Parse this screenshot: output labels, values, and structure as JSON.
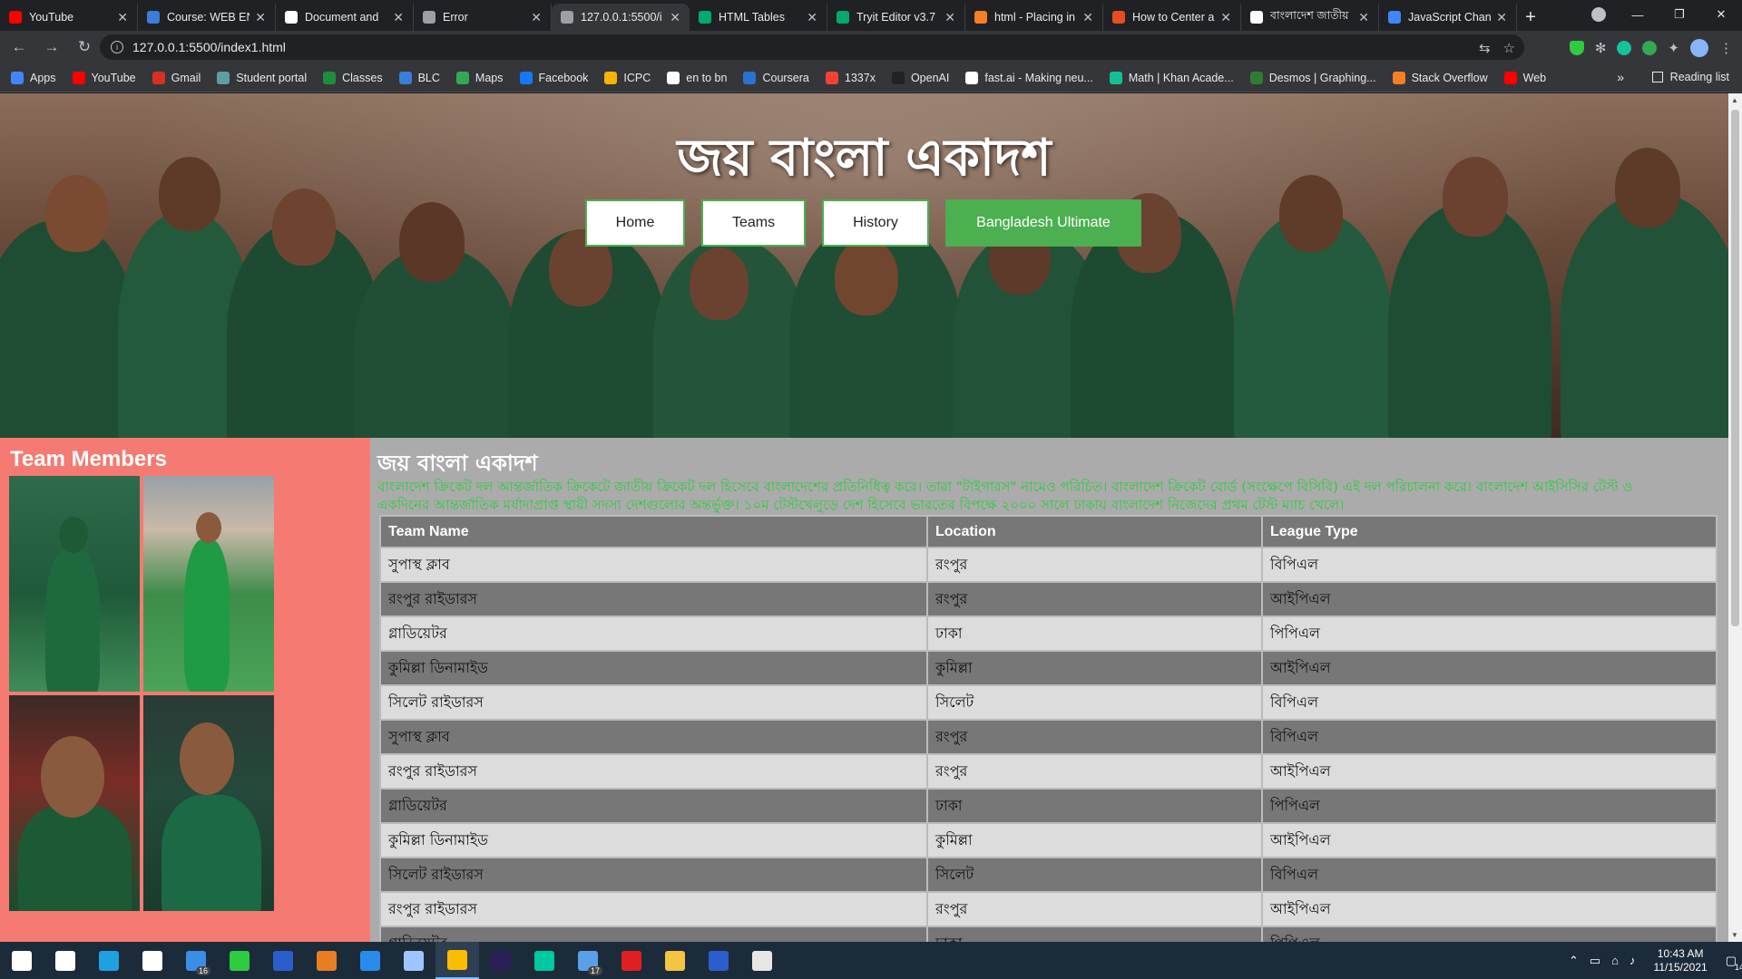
{
  "browser": {
    "tabs": [
      {
        "label": "YouTube",
        "icon": "youtube-icon",
        "color": "#ff0000"
      },
      {
        "label": "Course: WEB EN",
        "icon": "course-icon",
        "color": "#3b7dd8"
      },
      {
        "label": "Document and",
        "icon": "github-icon",
        "color": "#ffffff"
      },
      {
        "label": "Error",
        "icon": "globe-icon",
        "color": "#9aa0a6"
      },
      {
        "label": "127.0.0.1:5500/i",
        "icon": "globe-icon",
        "color": "#9aa0a6",
        "active": true
      },
      {
        "label": "HTML Tables",
        "icon": "w3schools-icon",
        "color": "#04aa6d"
      },
      {
        "label": "Tryit Editor v3.7",
        "icon": "w3schools-icon",
        "color": "#04aa6d"
      },
      {
        "label": "html - Placing in",
        "icon": "stackoverflow-icon",
        "color": "#f48024"
      },
      {
        "label": "How to Center a",
        "icon": "html5-icon",
        "color": "#e44d26"
      },
      {
        "label": "বাংলাদেশ জাতীয়",
        "icon": "wikipedia-icon",
        "color": "#ffffff"
      },
      {
        "label": "JavaScript Chan",
        "icon": "google-icon",
        "color": "#4285f4"
      }
    ],
    "url": "127.0.0.1:5500/index1.html",
    "bookmarks": [
      {
        "label": "Apps",
        "icon": "apps-icon",
        "color": "#4285f4"
      },
      {
        "label": "YouTube",
        "icon": "youtube-icon",
        "color": "#ff0000"
      },
      {
        "label": "Gmail",
        "icon": "gmail-icon",
        "color": "#d93025"
      },
      {
        "label": "Student portal",
        "icon": "portal-icon",
        "color": "#5f9ea0"
      },
      {
        "label": "Classes",
        "icon": "classroom-icon",
        "color": "#1e8e3e"
      },
      {
        "label": "BLC",
        "icon": "blc-icon",
        "color": "#3b7dd8"
      },
      {
        "label": "Maps",
        "icon": "maps-icon",
        "color": "#34a853"
      },
      {
        "label": "Facebook",
        "icon": "facebook-icon",
        "color": "#1877f2"
      },
      {
        "label": "ICPC",
        "icon": "icpc-icon",
        "color": "#f4b400"
      },
      {
        "label": "en to bn",
        "icon": "google-icon",
        "color": "#ffffff"
      },
      {
        "label": "Coursera",
        "icon": "coursera-icon",
        "color": "#2a73cc"
      },
      {
        "label": "1337x",
        "icon": "x-icon",
        "color": "#f44336"
      },
      {
        "label": "OpenAI",
        "icon": "openai-icon",
        "color": "#222222"
      },
      {
        "label": "fast.ai - Making neu...",
        "icon": "fastai-icon",
        "color": "#ffffff"
      },
      {
        "label": "Math | Khan Acade...",
        "icon": "khan-icon",
        "color": "#14bf96"
      },
      {
        "label": "Desmos | Graphing...",
        "icon": "desmos-icon",
        "color": "#2e7d32"
      },
      {
        "label": "Stack Overflow",
        "icon": "stackoverflow-icon",
        "color": "#f48024"
      },
      {
        "label": "Web",
        "icon": "youtube-icon",
        "color": "#ff0000"
      }
    ],
    "bookmarks_more": "»",
    "reading_list": "Reading list"
  },
  "page": {
    "hero_title": "জয় বাংলা একাদশ",
    "nav": [
      {
        "label": "Home",
        "active": false
      },
      {
        "label": "Teams",
        "active": false
      },
      {
        "label": "History",
        "active": false
      },
      {
        "label": "Bangladesh Ultimate",
        "active": true
      }
    ],
    "sidebar": {
      "title": "Team Members"
    },
    "main": {
      "heading": "জয় বাংলা একাদশ",
      "paragraph": "বাংলাদেশ ক্রিকেট দল আন্তর্জাতিক ক্রিকেটে জাতীয় ক্রিকেট দল হিসেবে বাংলাদেশের প্রতিনিধিত্ব করে। তারা \"টাইগারস\" নামেও পরিচিত। বাংলাদেশ ক্রিকেট বোর্ড (সংক্ষেপে বিসিবি) এই দল পরিচালনা করে। বাংলাদেশ আইসিসির টেস্ট ও একদিনের আন্তর্জাতিক মর্যাদাপ্রাপ্ত স্থায়ী সদস্য দেশগুলোর অন্তর্ভুক্ত। ১০ম টেস্টখেলুড়ে দেশ হিসেবে ভারতের বিপক্ষে ২০০০ সালে ঢাকায় বাংলাদেশ নিজেদের প্রথম টেস্ট ম্যাচ খেলে।",
      "table": {
        "headers": [
          "Team Name",
          "Location",
          "League Type"
        ],
        "rows": [
          [
            "সুপাস্থ ক্লাব",
            "রংপুর",
            "বিপিএল"
          ],
          [
            "রংপুর রাইডারস",
            "রংপুর",
            "আইপিএল"
          ],
          [
            "গ্লাডিয়েটর",
            "ঢাকা",
            "পিপিএল"
          ],
          [
            "কুমিল্লা ডিনামাইড",
            "কুমিল্লা",
            "আইপিএল"
          ],
          [
            "সিলেট রাইডারস",
            "সিলেট",
            "বিপিএল"
          ],
          [
            "সুপাস্থ ক্লাব",
            "রংপুর",
            "বিপিএল"
          ],
          [
            "রংপুর রাইডারস",
            "রংপুর",
            "আইপিএল"
          ],
          [
            "গ্লাডিয়েটর",
            "ঢাকা",
            "পিপিএল"
          ],
          [
            "কুমিল্লা ডিনামাইড",
            "কুমিল্লা",
            "আইপিএল"
          ],
          [
            "সিলেট রাইডারস",
            "সিলেট",
            "বিপিএল"
          ],
          [
            "রংপুর রাইডারস",
            "রংপুর",
            "আইপিএল"
          ],
          [
            "গ্লাডিয়েটর",
            "ঢাকা",
            "পিপিএল"
          ]
        ]
      }
    },
    "colors": {
      "nav_active": "#4caf50",
      "sidebar_bg": "#f47a72",
      "main_bg": "#ababab",
      "paragraph": "#2ecc40"
    }
  },
  "taskbar": {
    "apps": [
      {
        "name": "windows-start-icon",
        "color": "#ffffff"
      },
      {
        "name": "search-icon",
        "color": "#ffffff"
      },
      {
        "name": "edge-icon",
        "color": "#1fa0e0"
      },
      {
        "name": "store-icon",
        "color": "#ffffff"
      },
      {
        "name": "mail-icon",
        "color": "#3a8ee6",
        "badge": "16"
      },
      {
        "name": "circle-app-icon",
        "color": "#2ecc40"
      },
      {
        "name": "powershell-icon",
        "color": "#2b5dcd"
      },
      {
        "name": "office-grid-icon",
        "color": "#e67e22"
      },
      {
        "name": "vscode-icon",
        "color": "#2a8ce8"
      },
      {
        "name": "cortana-icon",
        "color": "#9ec5ff"
      },
      {
        "name": "chrome-icon",
        "color": "#fbbc05",
        "active": true
      },
      {
        "name": "premiere-icon",
        "color": "#2a1f55"
      },
      {
        "name": "audition-icon",
        "color": "#00c8a0"
      },
      {
        "name": "notes-icon",
        "color": "#5aa0e6",
        "badge": "17"
      },
      {
        "name": "acrobat-icon",
        "color": "#e02020"
      },
      {
        "name": "explorer-icon",
        "color": "#f4c542"
      },
      {
        "name": "word-icon",
        "color": "#2b5dcd"
      },
      {
        "name": "paint-icon",
        "color": "#e6e6e6"
      }
    ],
    "time": "10:43 AM",
    "date": "11/15/2021",
    "notifications": "14"
  }
}
